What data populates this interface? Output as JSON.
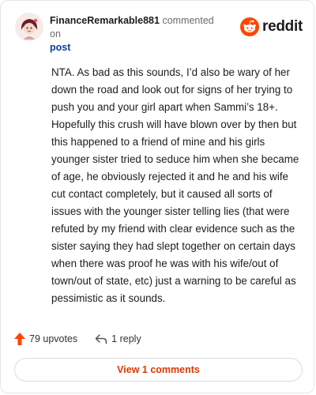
{
  "comment": {
    "username": "FinanceRemarkable881",
    "action_text": "commented on",
    "post_link": "post",
    "body": "NTA. As bad as this sounds, I’d also be wary of her down the road and look out for signs of her trying to push you and your girl apart when Sammi’s 18+. Hopefully this crush will have blown over by then but this happened to a friend of mine and his girls younger sister tried to seduce him when she became of age, he obviously rejected it and he and his wife cut contact completely, but it caused all sorts of issues with the younger sister telling lies (that were refuted by my friend with clear evidence such as the sister saying they had slept together on certain days when there was proof he was with his wife/out of town/out of state, etc) just a warning to be careful as pessimistic as it sounds.",
    "upvotes": "79 upvotes",
    "replies": "1 reply",
    "view_comments": "View 1 comments"
  },
  "brand": {
    "wordmark": "reddit",
    "color": "#ff4500"
  },
  "colors": {
    "link": "#0b3ea8",
    "accent": "#d93a00",
    "upvote": "#ff4500"
  },
  "icons": {
    "upvote": "upvote-arrow-icon",
    "reply": "reply-arrow-icon",
    "logo": "reddit-alien-icon",
    "avatar": "avatar-icon"
  }
}
